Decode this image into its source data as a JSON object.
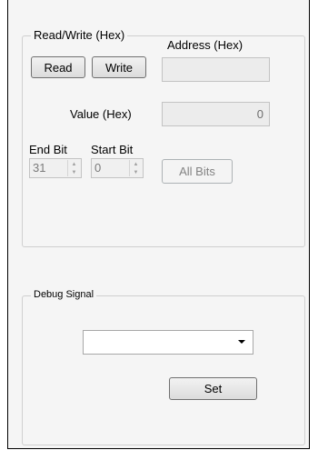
{
  "rw_group": {
    "title": "Read/Write (Hex)",
    "address_label": "Address (Hex)",
    "address_value": "",
    "read_label": "Read",
    "write_label": "Write",
    "value_label": "Value (Hex)",
    "value_value": "0",
    "end_bit_label": "End Bit",
    "start_bit_label": "Start Bit",
    "end_bit_value": "31",
    "start_bit_value": "0",
    "all_bits_label": "All Bits"
  },
  "debug_group": {
    "title": "Debug Signal",
    "selected": "",
    "set_label": "Set"
  },
  "colors": {
    "panel": "#f5f5f5",
    "group_border": "#cfcfcf"
  }
}
